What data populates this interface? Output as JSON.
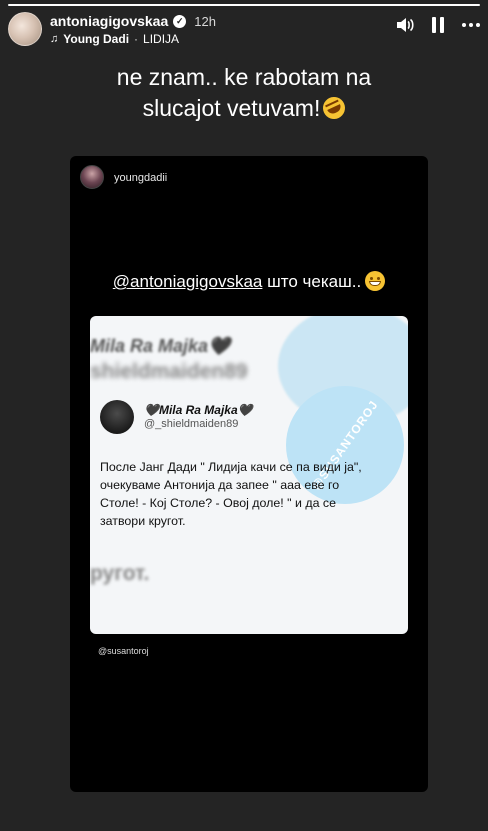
{
  "progress": {
    "fraction": 1.0
  },
  "header": {
    "username": "antoniagigovskaa",
    "time": "12h",
    "music_title": "Young Dadi",
    "music_separator": "·",
    "music_artist": "LIDIJA"
  },
  "icons": {
    "verified": "verified-badge-icon",
    "music": "music-note-icon",
    "volume": "volume-icon",
    "pause": "pause-icon",
    "more": "more-icon"
  },
  "caption": {
    "line1": "ne znam.. ke rabotam na",
    "line2": "slucajot vetuvam!"
  },
  "shared_post": {
    "username": "youngdadii",
    "mention": "@antoniagigovskaa",
    "mention_rest": " што чекаш..",
    "bg_name": "Mila Ra Majka🖤",
    "bg_handle": "shieldmaiden89",
    "bg_bottom": "ругот.",
    "watermark": "@SUSANTOROJ",
    "tweet_author": "🖤Mila Ra Majka🖤",
    "tweet_handle": "@_shieldmaiden89",
    "tweet_text": "После Јанг Дади \" Лидија качи се па види ја\", очекуваме Антонија да запее \" ааа еве го Столе!  - Кој Столе? - Овој доле! \" и да се затвори кругот.",
    "source_tag": "@susantoroj"
  },
  "colors": {
    "background": "#242424",
    "card": "#000000",
    "tweet_bg": "#f4f6f8",
    "watermark_blue": "#bde3f6"
  }
}
